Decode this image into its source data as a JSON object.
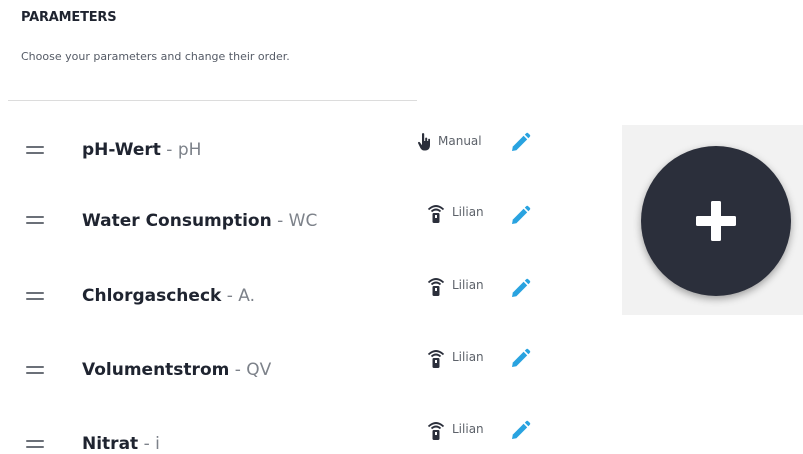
{
  "section": {
    "title": "PARAMETERS",
    "description": "Choose your parameters and change their order."
  },
  "parameters": [
    {
      "name": "pH-Wert",
      "separator": " - ",
      "code": "pH",
      "source": "Manual",
      "source_icon": "hand-pointer-icon"
    },
    {
      "name": "Water Consumption",
      "separator": " - ",
      "code": "WC",
      "source": "Lilian",
      "source_icon": "wireless-sensor-icon"
    },
    {
      "name": "Chlorgascheck",
      "separator": " - ",
      "code": "A.",
      "source": "Lilian",
      "source_icon": "wireless-sensor-icon"
    },
    {
      "name": "Volumentstrom",
      "separator": " - ",
      "code": "QV",
      "source": "Lilian",
      "source_icon": "wireless-sensor-icon"
    },
    {
      "name": "Nitrat",
      "separator": " - ",
      "code": "i",
      "source": "Lilian",
      "source_icon": "wireless-sensor-icon"
    }
  ],
  "icons": {
    "drag": "drag-handle-icon",
    "edit": "pencil-icon",
    "add": "plus-icon"
  },
  "colors": {
    "accent": "#29a3e0",
    "fab": "#2b2f3b",
    "text": "#1f2430",
    "muted": "#7d828a"
  }
}
